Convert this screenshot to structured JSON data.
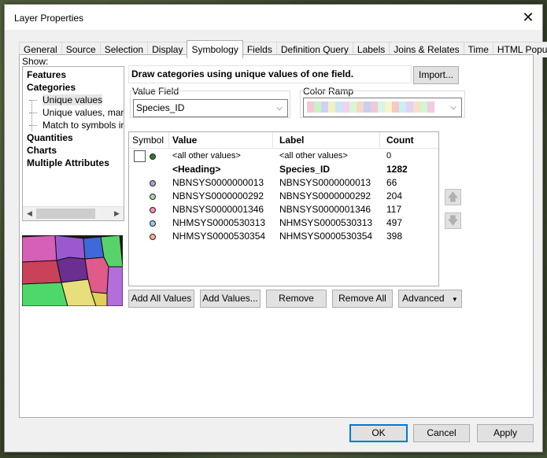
{
  "window": {
    "title": "Layer Properties"
  },
  "tabs": [
    "General",
    "Source",
    "Selection",
    "Display",
    "Symbology",
    "Fields",
    "Definition Query",
    "Labels",
    "Joins & Relates",
    "Time",
    "HTML Popup"
  ],
  "active_tab": "Symbology",
  "show": {
    "label": "Show:",
    "items": [
      {
        "label": "Features",
        "level": 0
      },
      {
        "label": "Categories",
        "level": 0
      },
      {
        "label": "Unique values",
        "level": 1,
        "selected": true
      },
      {
        "label": "Unique values, many",
        "level": 1
      },
      {
        "label": "Match to symbols in a",
        "level": 1
      },
      {
        "label": "Quantities",
        "level": 0
      },
      {
        "label": "Charts",
        "level": 0
      },
      {
        "label": "Multiple Attributes",
        "level": 0
      }
    ]
  },
  "description": "Draw categories using unique values of one field.",
  "import_label": "Import...",
  "value_field": {
    "label": "Value Field",
    "value": "Species_ID"
  },
  "color_ramp": {
    "label": "Color Ramp",
    "colors": [
      "#f7c6d7",
      "#c9f2c2",
      "#d0d0f5",
      "#f5f0c0",
      "#c8e6f5",
      "#f3d1f0",
      "#d7f7d0",
      "#f5d8c8",
      "#c9cef5",
      "#f0c8d9",
      "#d9f5e6",
      "#f5f5c8",
      "#f5c8c8",
      "#c8f0f5",
      "#e6d0f5",
      "#f5e0c8",
      "#d0f5d0",
      "#f5c8e6"
    ]
  },
  "table": {
    "headers": {
      "symbol": "Symbol",
      "value": "Value",
      "label": "Label",
      "count": "Count"
    },
    "rows": [
      {
        "value": "<all other values>",
        "label": "<all other values>",
        "count": "0",
        "kind": "other",
        "color": "#2e7d32"
      },
      {
        "value": "<Heading>",
        "label": "Species_ID",
        "count": "1282",
        "kind": "heading"
      },
      {
        "value": "NBNSYS0000000013",
        "label": "NBNSYS0000000013",
        "count": "66",
        "color": "#b39ddb"
      },
      {
        "value": "NBNSYS0000000292",
        "label": "NBNSYS0000000292",
        "count": "204",
        "color": "#a5d6a7"
      },
      {
        "value": "NBNSYS0000001346",
        "label": "NBNSYS0000001346",
        "count": "117",
        "color": "#f48fb1"
      },
      {
        "value": "NHMSYS0000530313",
        "label": "NHMSYS0000530313",
        "count": "497",
        "color": "#90caf9"
      },
      {
        "value": "NHMSYS0000530354",
        "label": "NHMSYS0000530354",
        "count": "398",
        "color": "#ffab91"
      }
    ]
  },
  "buttons": {
    "add_all": "Add All Values",
    "add_values": "Add Values...",
    "remove": "Remove",
    "remove_all": "Remove All",
    "advanced": "Advanced"
  },
  "footer": {
    "ok": "OK",
    "cancel": "Cancel",
    "apply": "Apply"
  }
}
